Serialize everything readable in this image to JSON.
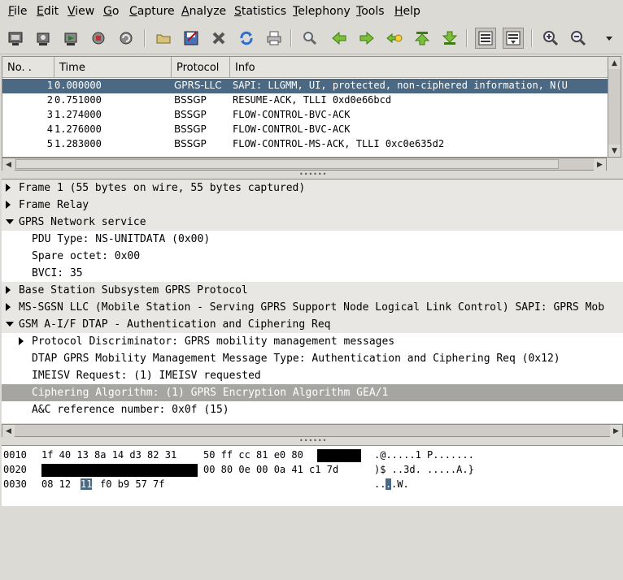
{
  "menu": [
    "File",
    "Edit",
    "View",
    "Go",
    "Capture",
    "Analyze",
    "Statistics",
    "Telephony",
    "Tools",
    "Help"
  ],
  "menu_underline": [
    "F",
    "E",
    "V",
    "G",
    "C",
    "A",
    "S",
    "T",
    "T",
    "H"
  ],
  "toolbar_icons": [
    "interface-list-icon",
    "capture-options-icon",
    "start-capture-icon",
    "stop-capture-icon",
    "restart-capture-icon",
    "open-file-icon",
    "save-file-icon",
    "close-file-icon",
    "reload-icon",
    "print-icon",
    "find-packet-icon",
    "go-back-icon",
    "go-forward-icon",
    "go-to-packet-icon",
    "go-first-icon",
    "go-last-icon",
    "colorize-icon",
    "auto-scroll-icon",
    "zoom-in-icon",
    "zoom-out-icon",
    "more-icon"
  ],
  "columns": [
    "No. .",
    "Time",
    "Protocol",
    "Info"
  ],
  "packets": [
    {
      "no": "1",
      "time": "0.000000",
      "protocol": "GPRS-LLC",
      "info": "SAPI: LLGMM, UI, protected, non-ciphered information, N(U"
    },
    {
      "no": "2",
      "time": "0.751000",
      "protocol": "BSSGP",
      "info": "RESUME-ACK, TLLI 0xd0e66bcd"
    },
    {
      "no": "3",
      "time": "1.274000",
      "protocol": "BSSGP",
      "info": "FLOW-CONTROL-BVC-ACK"
    },
    {
      "no": "4",
      "time": "1.276000",
      "protocol": "BSSGP",
      "info": "FLOW-CONTROL-BVC-ACK"
    },
    {
      "no": "5",
      "time": "1.283000",
      "protocol": "BSSGP",
      "info": "FLOW-CONTROL-MS-ACK, TLLI 0xc0e635d2"
    }
  ],
  "details": [
    {
      "text": "Frame 1 (55 bytes on wire, 55 bytes captured)",
      "level": 0,
      "expander": "right",
      "shade": true
    },
    {
      "text": "Frame Relay",
      "level": 0,
      "expander": "right",
      "shade": true
    },
    {
      "text": "GPRS Network service",
      "level": 0,
      "expander": "down",
      "shade": true
    },
    {
      "text": "PDU Type: NS-UNITDATA (0x00)",
      "level": 1,
      "expander": "none",
      "shade": false
    },
    {
      "text": "Spare octet: 0x00",
      "level": 1,
      "expander": "none",
      "shade": false
    },
    {
      "text": "BVCI: 35",
      "level": 1,
      "expander": "none",
      "shade": false
    },
    {
      "text": "Base Station Subsystem GPRS Protocol",
      "level": 0,
      "expander": "right",
      "shade": true
    },
    {
      "text": "MS-SGSN LLC (Mobile Station - Serving GPRS Support Node Logical Link Control)  SAPI: GPRS Mob",
      "level": 0,
      "expander": "right",
      "shade": true
    },
    {
      "text": "GSM A-I/F DTAP - Authentication and Ciphering Req",
      "level": 0,
      "expander": "down",
      "shade": true
    },
    {
      "text": "Protocol Discriminator: GPRS mobility management messages",
      "level": 1,
      "expander": "right",
      "shade": false
    },
    {
      "text": "DTAP GPRS Mobility Management Message Type: Authentication and Ciphering Req (0x12)",
      "level": 1,
      "expander": "none",
      "shade": false
    },
    {
      "text": "IMEISV Request: (1) IMEISV requested",
      "level": 1,
      "expander": "none",
      "shade": false
    },
    {
      "text": "Ciphering Algorithm: (1) GPRS Encryption Algorithm GEA/1",
      "level": 1,
      "expander": "none",
      "shade": false,
      "selected": true
    },
    {
      "text": "A&C reference number: 0x0f (15)",
      "level": 1,
      "expander": "none",
      "shade": false
    }
  ],
  "hex": [
    {
      "offset": "0010",
      "bytes_a": "1f 40 13 8a 14 d3 82 31",
      "bytes_b": "50 ff cc 81 e0 80",
      "ascii": ".@.....1 P......."
    },
    {
      "offset": "0020",
      "bytes_a": "",
      "bytes_b": "00 80 0e 00 0a 41 c1 7d",
      "ascii": ")$ ..3d. .....A.}"
    },
    {
      "offset": "0030",
      "bytes_pre": "08 12",
      "bytes_hl": "11",
      "bytes_post": "f0 b9 57 7f",
      "ascii_pre": "..",
      "ascii_hl": ".",
      "ascii_post": ".W."
    }
  ]
}
